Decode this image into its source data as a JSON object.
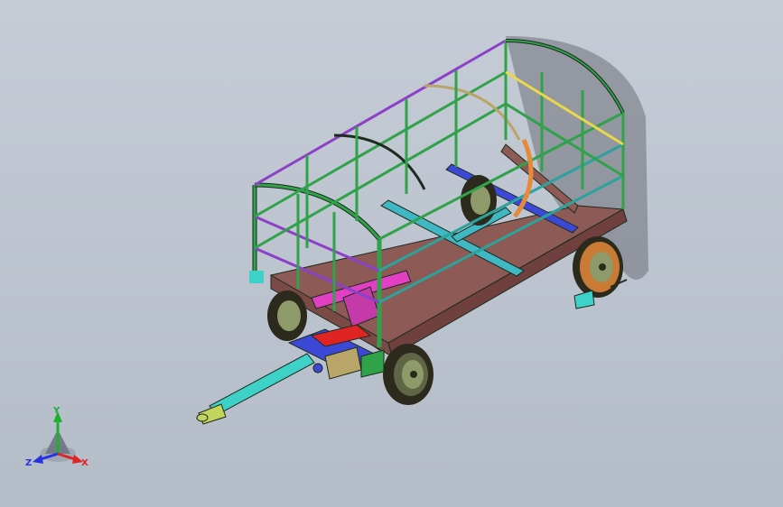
{
  "viewport": {
    "background_top": "#c5ccd6",
    "background_bottom": "#b4bcc8"
  },
  "model": {
    "name": "trailer-assembly",
    "colors": {
      "frame_outline": "#1d2a1d",
      "green_tube": "#2fa24a",
      "teal_tube": "#2ba39b",
      "purple_tube": "#8c3fc7",
      "orange_tube": "#e58a3a",
      "brown_chassis": "#8d5a55",
      "blue_crossmember": "#3c49d6",
      "cyan_crossmember": "#3fb8c4",
      "magenta_part": "#e23fc4",
      "yellow_part": "#e8d84a",
      "tire": "#2b2a1c",
      "rim": "#8f9a6a",
      "tow_bar": "#3ed1c8",
      "hitch": "#b8a567"
    }
  },
  "triad": {
    "x_label": "X",
    "y_label": "Y",
    "z_label": "Z",
    "x_color": "#e02424",
    "y_color": "#1fae2d",
    "z_color": "#2433e0"
  }
}
